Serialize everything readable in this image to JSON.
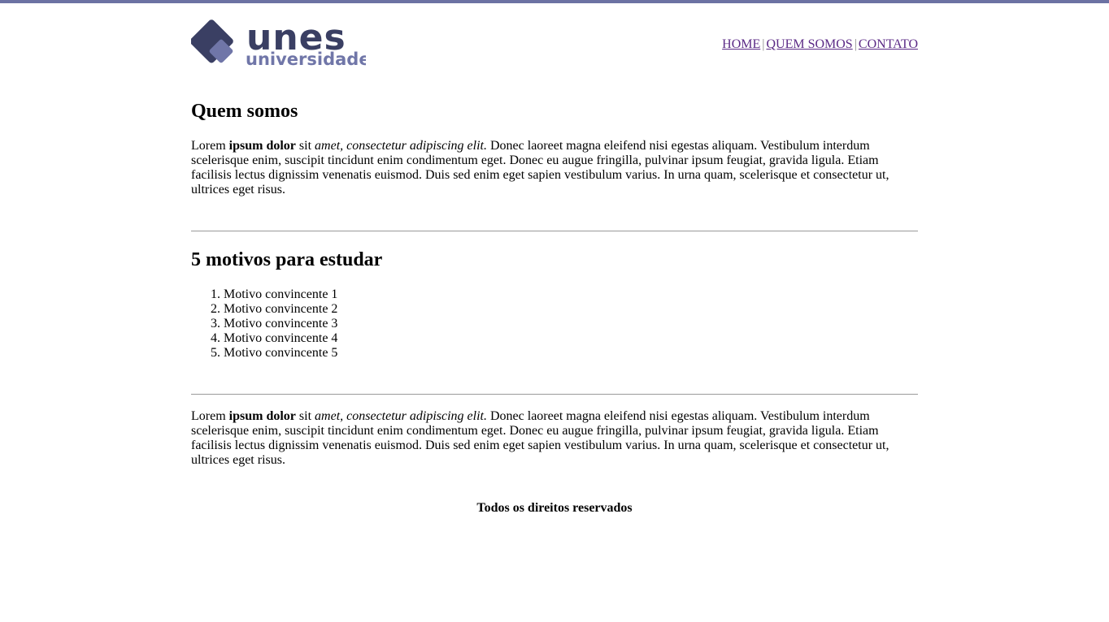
{
  "header": {
    "logo": {
      "brand_text": "unes",
      "sub_text": "universidade",
      "colors": {
        "dark": "#3a3f63",
        "light": "#7076a8"
      }
    },
    "nav": {
      "items": [
        {
          "label": "HOME"
        },
        {
          "label": "QUEM SOMOS"
        },
        {
          "label": "CONTATO"
        }
      ],
      "separator": "|"
    }
  },
  "section_about": {
    "title": "Quem somos",
    "paragraph": {
      "part1": "Lorem ",
      "bold": "ipsum dolor",
      "part2": " sit ",
      "italic": "amet, consectetur adipiscing elit.",
      "part3": " Donec laoreet magna eleifend nisi egestas aliquam. Vestibulum interdum scelerisque enim, suscipit tincidunt enim condimentum eget. Donec eu augue fringilla, pulvinar ipsum feugiat, gravida ligula. Etiam facilisis lectus dignissim venenatis euismod. Duis sed enim eget sapien vestibulum varius. In urna quam, scelerisque et consectetur ut, ultrices eget risus."
    }
  },
  "section_reasons": {
    "title": "5 motivos para estudar",
    "items": [
      "Motivo convincente 1",
      "Motivo convincente 2",
      "Motivo convincente 3",
      "Motivo convincente 4",
      "Motivo convincente 5"
    ]
  },
  "section_closing": {
    "paragraph": {
      "part1": "Lorem ",
      "bold": "ipsum dolor",
      "part2": " sit ",
      "italic": "amet, consectetur adipiscing elit.",
      "part3": " Donec laoreet magna eleifend nisi egestas aliquam. Vestibulum interdum scelerisque enim, suscipit tincidunt enim condimentum eget. Donec eu augue fringilla, pulvinar ipsum feugiat, gravida ligula. Etiam facilisis lectus dignissim venenatis euismod. Duis sed enim eget sapien vestibulum varius. In urna quam, scelerisque et consectetur ut, ultrices eget risus."
    }
  },
  "footer": {
    "text": "Todos os direitos reservados"
  },
  "theme": {
    "accent": "#6c72a3",
    "link": "#5b2a86"
  }
}
